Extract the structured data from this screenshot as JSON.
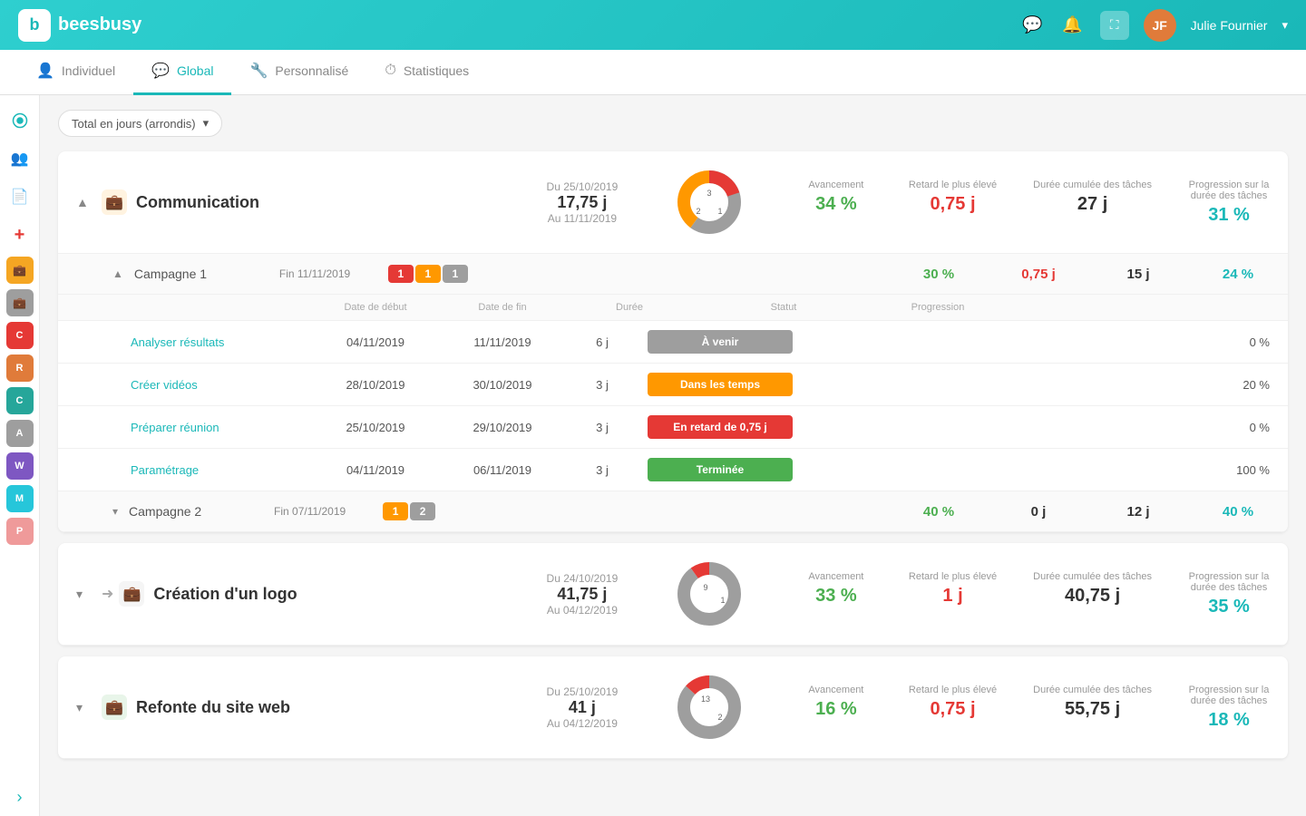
{
  "app": {
    "name": "beesbusy",
    "user": {
      "name": "Julie Fournier",
      "avatar_text": "JF"
    }
  },
  "tabs": [
    {
      "id": "individuel",
      "label": "Individuel",
      "icon": "👤",
      "active": false
    },
    {
      "id": "global",
      "label": "Global",
      "icon": "💬",
      "active": true
    },
    {
      "id": "personnalise",
      "label": "Personnalisé",
      "icon": "🔧",
      "active": false
    },
    {
      "id": "statistiques",
      "label": "Statistiques",
      "icon": "⏱",
      "active": false
    }
  ],
  "filter": {
    "label": "Total en jours (arrondis)"
  },
  "projects": [
    {
      "id": "communication",
      "name": "Communication",
      "icon": "💼",
      "icon_color": "#f5a623",
      "expanded": true,
      "date_from": "Du 25/10/2019",
      "duration": "17,75 j",
      "date_to": "Au 11/11/2019",
      "donut": {
        "segments": [
          {
            "label": "3",
            "color": "#9e9e9e",
            "value": 3
          },
          {
            "label": "2",
            "color": "#ff9800",
            "value": 2
          },
          {
            "label": "1",
            "color": "#e53935",
            "value": 1
          }
        ]
      },
      "stats": {
        "avancement": {
          "label": "Avancement",
          "value": "34 %",
          "color": "green"
        },
        "retard": {
          "label": "Retard le plus élevé",
          "value": "0,75 j",
          "color": "red"
        },
        "duree": {
          "label": "Durée cumulée des tâches",
          "value": "27 j",
          "color": "dark"
        },
        "progression": {
          "label": "Progression sur la durée des tâches",
          "value": "31 %",
          "color": "teal"
        }
      },
      "sub_groups": [
        {
          "id": "campagne1",
          "name": "Campagne 1",
          "expanded": true,
          "date_info": "Fin 11/11/2019",
          "badges": [
            {
              "value": "1",
              "color": "red"
            },
            {
              "value": "1",
              "color": "orange"
            },
            {
              "value": "1",
              "color": "gray"
            }
          ],
          "stats": {
            "avancement": {
              "value": "30 %",
              "color": "green"
            },
            "retard": {
              "value": "0,75 j",
              "color": "red"
            },
            "duree": {
              "value": "15 j",
              "color": "dark"
            },
            "progression": {
              "value": "24 %",
              "color": "teal"
            }
          },
          "tasks": [
            {
              "name": "Analyser résultats",
              "date_debut": "04/11/2019",
              "date_fin": "11/11/2019",
              "duree": "6 j",
              "statut": "À venir",
              "statut_color": "gray",
              "progression": "0 %"
            },
            {
              "name": "Créer vidéos",
              "date_debut": "28/10/2019",
              "date_fin": "30/10/2019",
              "duree": "3 j",
              "statut": "Dans les temps",
              "statut_color": "orange",
              "progression": "20 %"
            },
            {
              "name": "Préparer réunion",
              "date_debut": "25/10/2019",
              "date_fin": "29/10/2019",
              "duree": "3 j",
              "statut": "En retard de 0,75 j",
              "statut_color": "red",
              "progression": "0 %"
            },
            {
              "name": "Paramétrage",
              "date_debut": "04/11/2019",
              "date_fin": "06/11/2019",
              "duree": "3 j",
              "statut": "Terminée",
              "statut_color": "green",
              "progression": "100 %"
            }
          ]
        },
        {
          "id": "campagne2",
          "name": "Campagne 2",
          "expanded": false,
          "date_info": "Fin 07/11/2019",
          "badges": [
            {
              "value": "1",
              "color": "orange"
            },
            {
              "value": "2",
              "color": "gray"
            }
          ],
          "stats": {
            "avancement": {
              "value": "40 %",
              "color": "green"
            },
            "retard": {
              "value": "0 j",
              "color": "dark"
            },
            "duree": {
              "value": "12 j",
              "color": "dark"
            },
            "progression": {
              "value": "40 %",
              "color": "teal"
            }
          },
          "tasks": []
        }
      ]
    },
    {
      "id": "creation-logo",
      "name": "Création d'un logo",
      "icon": "💼",
      "icon_color": "#9e9e9e",
      "has_arrow": true,
      "expanded": false,
      "date_from": "Du 24/10/2019",
      "duration": "41,75 j",
      "date_to": "Au 04/12/2019",
      "donut": {
        "segments": [
          {
            "label": "9",
            "color": "#9e9e9e",
            "value": 9
          },
          {
            "label": "1",
            "color": "#e53935",
            "value": 1
          }
        ]
      },
      "stats": {
        "avancement": {
          "label": "Avancement",
          "value": "33 %",
          "color": "green"
        },
        "retard": {
          "label": "Retard le plus élevé",
          "value": "1 j",
          "color": "red"
        },
        "duree": {
          "label": "Durée cumulée des tâches",
          "value": "40,75 j",
          "color": "dark"
        },
        "progression": {
          "label": "Progression sur la durée des tâches",
          "value": "35 %",
          "color": "teal"
        }
      },
      "sub_groups": []
    },
    {
      "id": "refonte-site",
      "name": "Refonte du site web",
      "icon": "💼",
      "icon_color": "#4caf50",
      "expanded": false,
      "date_from": "Du 25/10/2019",
      "duration": "41 j",
      "date_to": "Au 04/12/2019",
      "donut": {
        "segments": [
          {
            "label": "13",
            "color": "#9e9e9e",
            "value": 13
          },
          {
            "label": "2",
            "color": "#e53935",
            "value": 2
          }
        ]
      },
      "stats": {
        "avancement": {
          "label": "Avancement",
          "value": "16 %",
          "color": "green"
        },
        "retard": {
          "label": "Retard le plus élevé",
          "value": "0,75 j",
          "color": "red"
        },
        "duree": {
          "label": "Durée cumulée des tâches",
          "value": "55,75 j",
          "color": "dark"
        },
        "progression": {
          "label": "Progression sur la durée des tâches",
          "value": "18 %",
          "color": "teal"
        }
      },
      "sub_groups": []
    }
  ],
  "sidebar": {
    "items": [
      {
        "icon": "🔍",
        "color": "",
        "label": ""
      },
      {
        "icon": "👥",
        "color": "",
        "label": ""
      },
      {
        "icon": "📄",
        "color": "",
        "label": ""
      },
      {
        "icon": "➕",
        "color": "",
        "label": ""
      },
      {
        "icon": "💼",
        "color": "#f5a623",
        "label": ""
      },
      {
        "icon": "💼",
        "color": "#9e9e9e",
        "label": ""
      },
      {
        "icon": "💼",
        "color": "#e53935",
        "label": ""
      },
      {
        "icon": "💼",
        "color": "#ff9800",
        "label": ""
      },
      {
        "icon": "💼",
        "color": "#e91e63",
        "label": ""
      }
    ]
  },
  "task_headers": {
    "col1": "",
    "date_debut": "Date de début",
    "date_fin": "Date de fin",
    "duree": "Durée",
    "statut": "Statut",
    "progression": "Progression"
  }
}
